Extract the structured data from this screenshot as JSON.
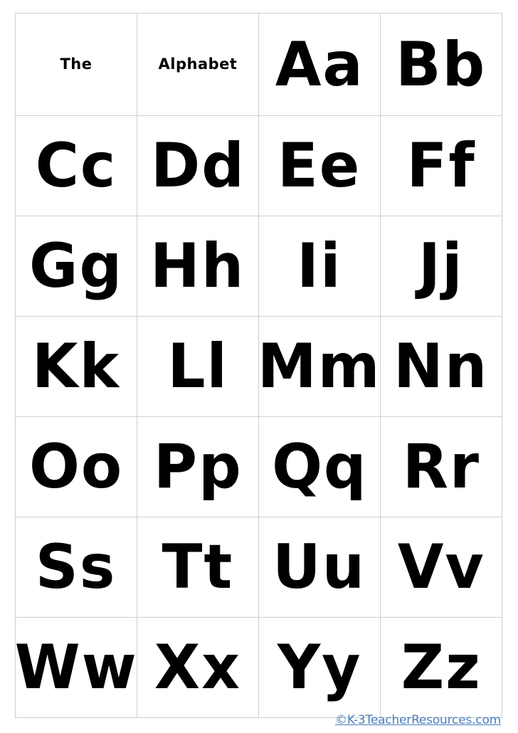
{
  "page": {
    "title": "The Alphabet",
    "background_color": "#ffffff",
    "grid_line_color": "#cfcfcf",
    "text_color": "#000000"
  },
  "grid": {
    "columns": 4,
    "rows": 7,
    "cells": [
      {
        "kind": "title",
        "text": "The"
      },
      {
        "kind": "title",
        "text": "Alphabet"
      },
      {
        "kind": "letter",
        "text": "Aa"
      },
      {
        "kind": "letter",
        "text": "Bb"
      },
      {
        "kind": "letter",
        "text": "Cc"
      },
      {
        "kind": "letter",
        "text": "Dd"
      },
      {
        "kind": "letter",
        "text": "Ee"
      },
      {
        "kind": "letter",
        "text": "Ff"
      },
      {
        "kind": "letter",
        "text": "Gg"
      },
      {
        "kind": "letter",
        "text": "Hh"
      },
      {
        "kind": "letter",
        "text": "Ii"
      },
      {
        "kind": "letter",
        "text": "Jj"
      },
      {
        "kind": "letter",
        "text": "Kk"
      },
      {
        "kind": "letter",
        "text": "Ll"
      },
      {
        "kind": "letter",
        "text": "Mm"
      },
      {
        "kind": "letter",
        "text": "Nn"
      },
      {
        "kind": "letter",
        "text": "Oo"
      },
      {
        "kind": "letter",
        "text": "Pp"
      },
      {
        "kind": "letter",
        "text": "Qq"
      },
      {
        "kind": "letter",
        "text": "Rr"
      },
      {
        "kind": "letter",
        "text": "Ss"
      },
      {
        "kind": "letter",
        "text": "Tt"
      },
      {
        "kind": "letter",
        "text": "Uu"
      },
      {
        "kind": "letter",
        "text": "Vv"
      },
      {
        "kind": "letter",
        "text": "Ww"
      },
      {
        "kind": "letter",
        "text": "Xx"
      },
      {
        "kind": "letter",
        "text": "Yy"
      },
      {
        "kind": "letter",
        "text": "Zz"
      }
    ]
  },
  "credit": {
    "text": "©K-3TeacherResources.com",
    "color": "#4a7ebb"
  }
}
